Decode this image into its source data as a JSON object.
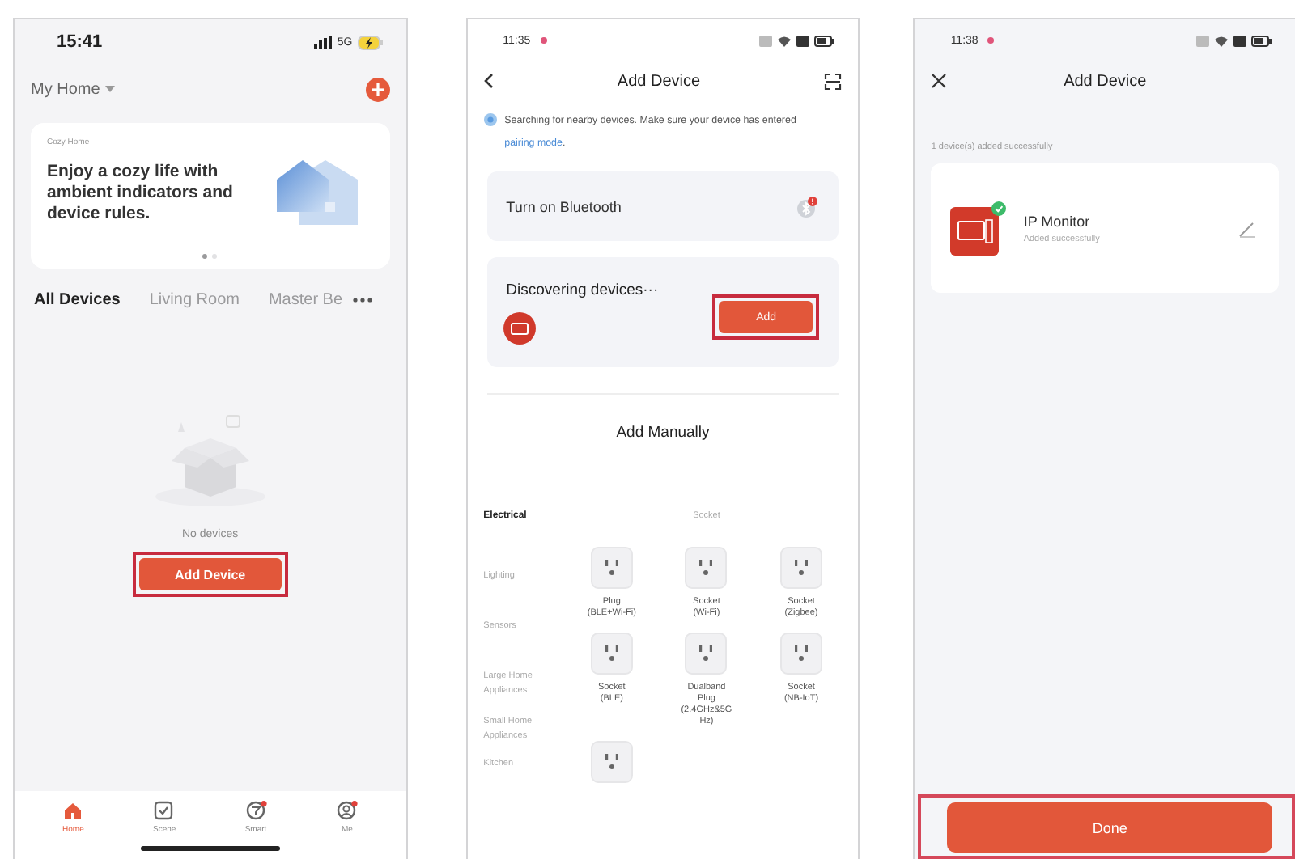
{
  "home_screen": {
    "status_bar": {
      "time": "15:41",
      "network": "5G"
    },
    "header": {
      "home_name": "My Home"
    },
    "banner": {
      "caption": "Cozy Home",
      "headline": "Enjoy a cozy life with ambient indicators and device rules.",
      "pages": [
        {
          "selected": true
        },
        {
          "selected": false
        }
      ]
    },
    "room_tabs": [
      {
        "label": "All Devices",
        "selected": true
      },
      {
        "label": "Living Room",
        "selected": false
      },
      {
        "label": "Master Be",
        "selected": false
      }
    ],
    "empty_state": {
      "message": "No devices",
      "button": {
        "label": "Add Device",
        "highlighted": true
      }
    },
    "tab_bar": [
      {
        "label": "Home",
        "selected": true,
        "badge": false
      },
      {
        "label": "Scene",
        "selected": false,
        "badge": false
      },
      {
        "label": "Smart",
        "selected": false,
        "badge": true
      },
      {
        "label": "Me",
        "selected": false,
        "badge": true
      }
    ]
  },
  "add_device_screen": {
    "status_bar": {
      "time": "11:35"
    },
    "title": "Add Device",
    "notice": {
      "text": "Searching for nearby devices. Make sure your device has entered ",
      "link": "pairing mode",
      "tail": "."
    },
    "bluetooth_card": {
      "label": "Turn on Bluetooth",
      "alert": true
    },
    "discovery_card": {
      "label": "Discovering devices···",
      "button": {
        "label": "Add",
        "highlighted": true
      }
    },
    "manual_section": {
      "title": "Add Manually",
      "categories": [
        {
          "label": "Electrical",
          "selected": true
        },
        {
          "label": "Lighting",
          "selected": false
        },
        {
          "label": "Sensors",
          "selected": false
        },
        {
          "label": "Large Home Appliances",
          "selected": false
        },
        {
          "label": "Small Home Appliances",
          "selected": false
        },
        {
          "label": "Kitchen",
          "selected": false
        }
      ],
      "group_title": "Socket",
      "products": [
        {
          "label": "Plug\n(BLE+Wi-Fi)"
        },
        {
          "label": "Socket\n(Wi-Fi)"
        },
        {
          "label": "Socket\n(Zigbee)"
        },
        {
          "label": "Socket\n(BLE)"
        },
        {
          "label": "Dualband\nPlug\n(2.4GHz&5G\nHz)"
        },
        {
          "label": "Socket\n(NB-IoT)"
        }
      ]
    }
  },
  "success_screen": {
    "status_bar": {
      "time": "11:38"
    },
    "title": "Add Device",
    "message": "1 device(s) added successfully",
    "devices": [
      {
        "name": "IP Monitor",
        "status": "Added successfully",
        "added": true
      }
    ],
    "done_button": {
      "label": "Done",
      "highlighted": true
    }
  }
}
